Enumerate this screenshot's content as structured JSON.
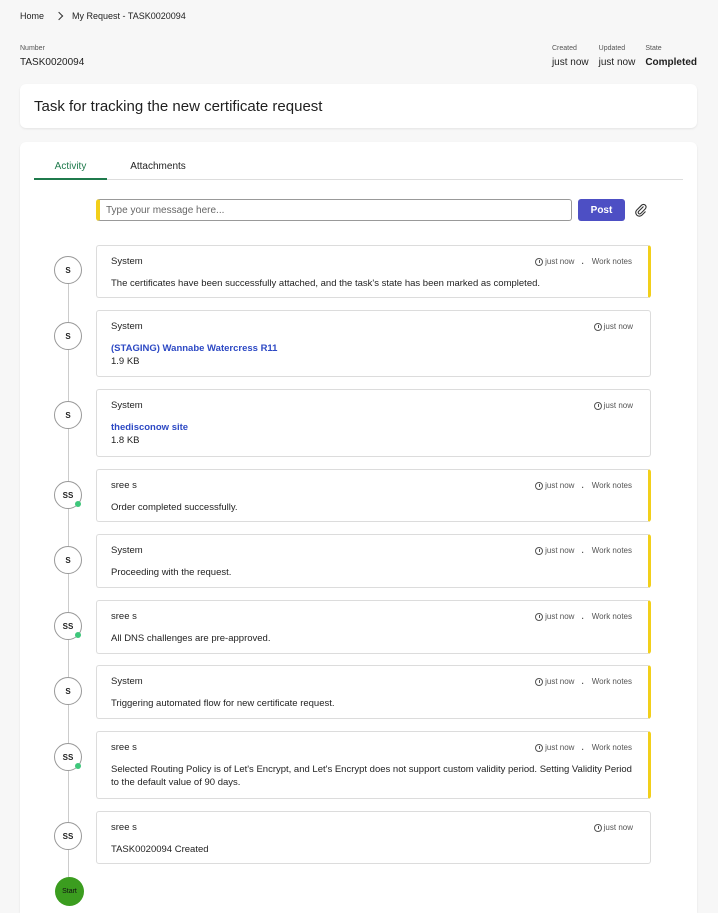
{
  "breadcrumb": {
    "home": "Home",
    "current": "My Request - TASK0020094"
  },
  "header": {
    "number_label": "Number",
    "number_value": "TASK0020094",
    "created_label": "Created",
    "created_value": "just now",
    "updated_label": "Updated",
    "updated_value": "just now",
    "state_label": "State",
    "state_value": "Completed"
  },
  "title": "Task for tracking the new certificate request",
  "tabs": {
    "activity": "Activity",
    "attachments": "Attachments"
  },
  "composer": {
    "placeholder": "Type your message here...",
    "post_label": "Post",
    "attach_icon": "paperclip-icon"
  },
  "accent": {
    "worknote": "#f2cf1a",
    "post": "#4d4fc4",
    "tab": "#1f7a4c",
    "link": "#2d49c4",
    "start": "#3b9d1f"
  },
  "entries": [
    {
      "avatar": "S",
      "author": "System",
      "time": "just now",
      "tag": "Work notes",
      "text": "The certificates have been successfully attached, and the task's state has been marked as completed."
    },
    {
      "avatar": "S",
      "author": "System",
      "time": "just now",
      "link": "(STAGING) Wannabe Watercress R11",
      "size": "1.9 KB"
    },
    {
      "avatar": "S",
      "author": "System",
      "time": "just now",
      "link": "thedisconow site",
      "size": "1.8 KB"
    },
    {
      "avatar": "SS",
      "author": "sree s",
      "time": "just now",
      "tag": "Work notes",
      "text": "Order completed successfully."
    },
    {
      "avatar": "S",
      "author": "System",
      "time": "just now",
      "tag": "Work notes",
      "text": "Proceeding with the request."
    },
    {
      "avatar": "SS",
      "author": "sree s",
      "time": "just now",
      "tag": "Work notes",
      "text": "All DNS challenges are pre-approved."
    },
    {
      "avatar": "S",
      "author": "System",
      "time": "just now",
      "tag": "Work notes",
      "text": "Triggering automated flow for new certificate request."
    },
    {
      "avatar": "SS",
      "author": "sree s",
      "time": "just now",
      "tag": "Work notes",
      "text": "Selected Routing Policy is of Let's Encrypt, and Let's Encrypt does not support custom validity period. Setting Validity Period to the default value of 90 days."
    },
    {
      "avatar": "SS",
      "author": "sree s",
      "time": "just now",
      "text": "TASK0020094 Created"
    }
  ],
  "start_label": "Start"
}
